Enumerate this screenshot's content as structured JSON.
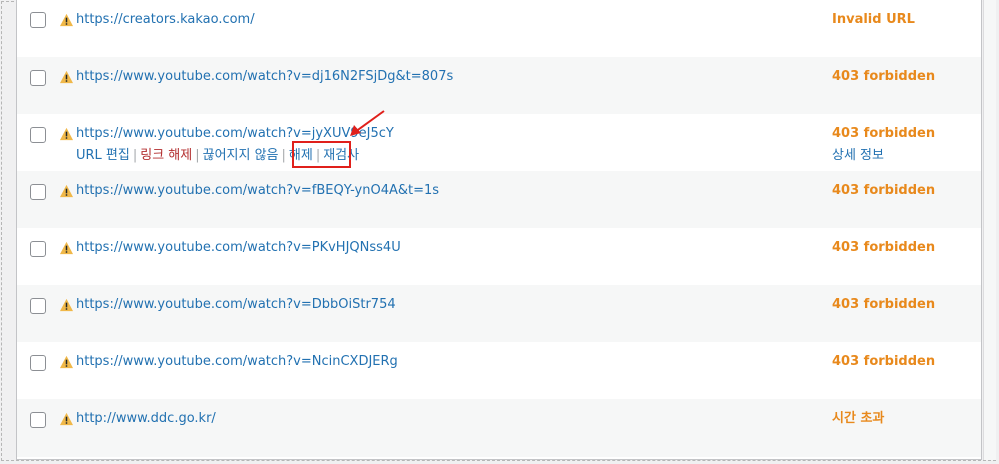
{
  "rows": [
    {
      "url": "https://creators.kakao.com/",
      "status": "Invalid URL"
    },
    {
      "url": "https://www.youtube.com/watch?v=dj16N2FSjDg&t=807s",
      "status": "403 forbidden"
    },
    {
      "url": "https://www.youtube.com/watch?v=jyXUV9eJ5cY",
      "status": "403 forbidden"
    },
    {
      "url": "https://www.youtube.com/watch?v=fBEQY-ynO4A&t=1s",
      "status": "403 forbidden"
    },
    {
      "url": "https://www.youtube.com/watch?v=PKvHJQNss4U",
      "status": "403 forbidden"
    },
    {
      "url": "https://www.youtube.com/watch?v=DbbOiStr754",
      "status": "403 forbidden"
    },
    {
      "url": "https://www.youtube.com/watch?v=NcinCXDJERg",
      "status": "403 forbidden"
    },
    {
      "url": "http://www.ddc.go.kr/",
      "status": "시간 초과"
    }
  ],
  "row_actions": {
    "edit_url": "URL 편집",
    "unlink": "링크 해제",
    "not_broken": "끊어지지 않음",
    "dismiss": "해제",
    "recheck": "재검사",
    "details": "상세 정보",
    "separator": "|"
  },
  "colors": {
    "status": "#e8891c",
    "link": "#2271b1",
    "danger": "#b32d2e",
    "highlight": "#e0201b"
  },
  "icons": {
    "warning": "warning-icon"
  }
}
